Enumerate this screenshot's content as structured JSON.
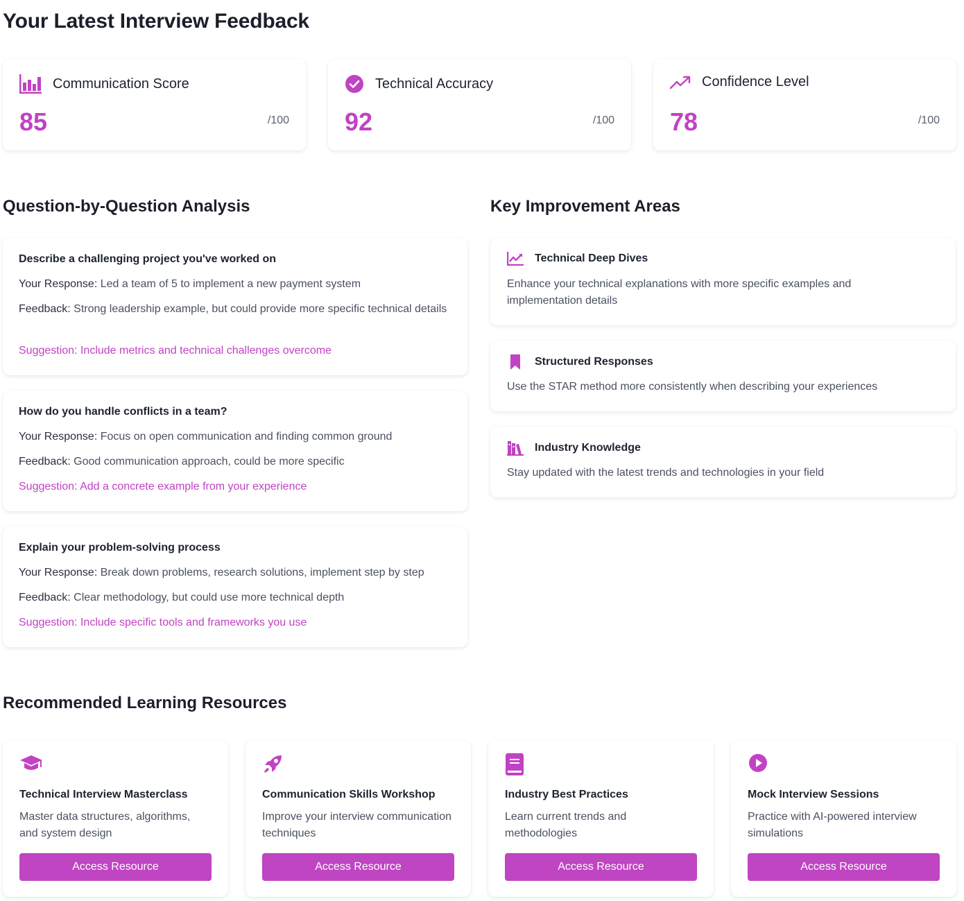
{
  "page": {
    "title": "Your Latest Interview Feedback"
  },
  "colors": {
    "accent": "#c142c4",
    "button": "#bf45c3",
    "heading": "#1b1f2a",
    "body_text": "#4a5060"
  },
  "scores": [
    {
      "icon": "bar-chart-icon",
      "title": "Communication Score",
      "value": "85",
      "max": "/100"
    },
    {
      "icon": "check-circle-icon",
      "title": "Technical Accuracy",
      "value": "92",
      "max": "/100"
    },
    {
      "icon": "trending-up-icon",
      "title": "Confidence Level",
      "value": "78",
      "max": "/100"
    }
  ],
  "analysis": {
    "title": "Question-by-Question Analysis",
    "questions": [
      {
        "question": "Describe a challenging project you've worked on",
        "response_label": "Your Response:",
        "response": "Led a team of 5 to implement a new payment system",
        "feedback_label": "Feedback:",
        "feedback": "Strong leadership example, but could provide more specific technical details",
        "suggestion_label": "Suggestion:",
        "suggestion": "Include metrics and technical challenges overcome"
      },
      {
        "question": "How do you handle conflicts in a team?",
        "response_label": "Your Response:",
        "response": "Focus on open communication and finding common ground",
        "feedback_label": "Feedback:",
        "feedback": "Good communication approach, could be more specific",
        "suggestion_label": "Suggestion:",
        "suggestion": "Add a concrete example from your experience"
      },
      {
        "question": "Explain your problem-solving process",
        "response_label": "Your Response:",
        "response": "Break down problems, research solutions, implement step by step",
        "feedback_label": "Feedback:",
        "feedback": "Clear methodology, but could use more technical depth",
        "suggestion_label": "Suggestion:",
        "suggestion": "Include specific tools and frameworks you use"
      }
    ]
  },
  "improvements": {
    "title": "Key Improvement Areas",
    "items": [
      {
        "icon": "chart-line-icon",
        "title": "Technical Deep Dives",
        "description": "Enhance your technical explanations with more specific examples and implementation details"
      },
      {
        "icon": "bookmark-icon",
        "title": "Structured Responses",
        "description": "Use the STAR method more consistently when describing your experiences"
      },
      {
        "icon": "books-icon",
        "title": "Industry Knowledge",
        "description": "Stay updated with the latest trends and technologies in your field"
      }
    ]
  },
  "resources": {
    "title": "Recommended Learning Resources",
    "items": [
      {
        "icon": "graduation-cap-icon",
        "title": "Technical Interview Masterclass",
        "description": "Master data structures, algorithms, and system design",
        "button": "Access Resource"
      },
      {
        "icon": "rocket-icon",
        "title": "Communication Skills Workshop",
        "description": "Improve your interview communication techniques",
        "button": "Access Resource"
      },
      {
        "icon": "book-icon",
        "title": "Industry Best Practices",
        "description": "Learn current trends and methodologies",
        "button": "Access Resource"
      },
      {
        "icon": "play-circle-icon",
        "title": "Mock Interview Sessions",
        "description": "Practice with AI-powered interview simulations",
        "button": "Access Resource"
      }
    ]
  }
}
